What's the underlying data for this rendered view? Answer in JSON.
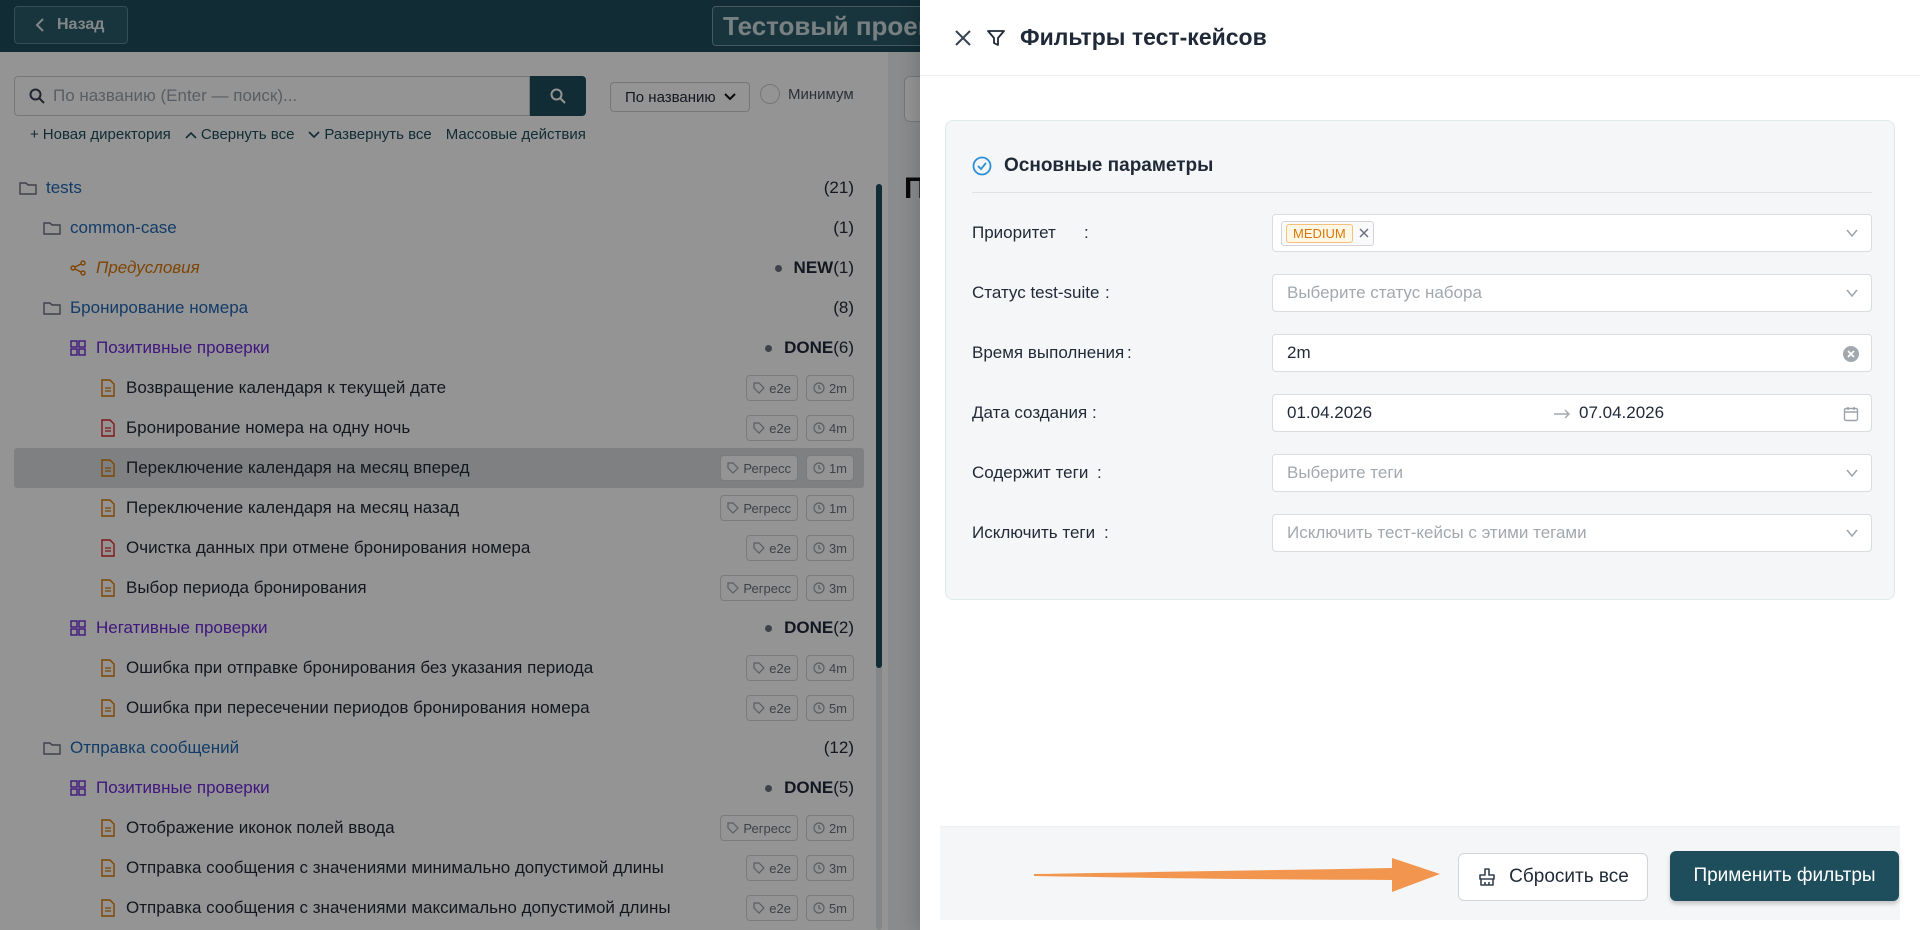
{
  "topbar": {
    "back_label": "Назад",
    "project_title": "Тестовый проект"
  },
  "toolbar": {
    "search_placeholder": "По названию (Enter — поиск)...",
    "sort_value": "По названию",
    "minimum_label": "Минимум"
  },
  "actions": {
    "new_dir": "Новая директория",
    "collapse_all": "Свернуть все",
    "expand_all": "Развернуть все",
    "bulk": "Массовые действия"
  },
  "tree": [
    {
      "kind": "dir",
      "level": 0,
      "label": "tests",
      "count": "(21)"
    },
    {
      "kind": "dir",
      "level": 1,
      "label": "common-case",
      "count": "(1)"
    },
    {
      "kind": "pre",
      "level": 2,
      "label": "Предусловия",
      "status": "NEW",
      "count": "(1)"
    },
    {
      "kind": "dir",
      "level": 1,
      "label": "Бронирование номера",
      "count": "(8)"
    },
    {
      "kind": "suite",
      "level": 2,
      "label": "Позитивные проверки",
      "status": "DONE",
      "count": "(6)"
    },
    {
      "kind": "case",
      "level": 3,
      "label": "Возвращение календаря к текущей дате",
      "tag": "e2e",
      "time": "2m",
      "icon_color": "#d97706"
    },
    {
      "kind": "case",
      "level": 3,
      "label": "Бронирование номера на одну ночь",
      "tag": "e2e",
      "time": "4m",
      "icon_color": "#dc2626"
    },
    {
      "kind": "case",
      "level": 3,
      "label": "Переключение календаря на месяц вперед",
      "tag": "Регресс",
      "time": "1m",
      "icon_color": "#d97706",
      "selected": true
    },
    {
      "kind": "case",
      "level": 3,
      "label": "Переключение календаря на месяц назад",
      "tag": "Регресс",
      "time": "1m",
      "icon_color": "#d97706"
    },
    {
      "kind": "case",
      "level": 3,
      "label": "Очистка данных при отмене бронирования номера",
      "tag": "e2e",
      "time": "3m",
      "icon_color": "#dc2626"
    },
    {
      "kind": "case",
      "level": 3,
      "label": "Выбор периода бронирования",
      "tag": "Регресс",
      "time": "3m",
      "icon_color": "#d97706"
    },
    {
      "kind": "suite",
      "level": 2,
      "label": "Негативные проверки",
      "status": "DONE",
      "count": "(2)"
    },
    {
      "kind": "case",
      "level": 3,
      "label": "Ошибка при отправке бронирования без указания периода",
      "tag": "e2e",
      "time": "4m",
      "icon_color": "#d97706"
    },
    {
      "kind": "case",
      "level": 3,
      "label": "Ошибка при пересечении периодов бронирования номера",
      "tag": "e2e",
      "time": "5m",
      "icon_color": "#d97706"
    },
    {
      "kind": "dir",
      "level": 1,
      "label": "Отправка сообщений",
      "count": "(12)"
    },
    {
      "kind": "suite",
      "level": 2,
      "label": "Позитивные проверки",
      "status": "DONE",
      "count": "(5)"
    },
    {
      "kind": "case",
      "level": 3,
      "label": "Отображение иконок полей ввода",
      "tag": "Регресс",
      "time": "2m",
      "icon_color": "#d97706"
    },
    {
      "kind": "case",
      "level": 3,
      "label": "Отправка сообщения с значениями минимально допустимой длины",
      "tag": "e2e",
      "time": "3m",
      "icon_color": "#d97706"
    },
    {
      "kind": "case",
      "level": 3,
      "label": "Отправка сообщения с значениями максимально допустимой длины",
      "tag": "e2e",
      "time": "5m",
      "icon_color": "#d97706"
    }
  ],
  "right_panel": {
    "heading_letter": "П"
  },
  "drawer": {
    "title": "Фильтры тест-кейсов",
    "section_title": "Основные параметры",
    "fields": {
      "priority": {
        "label": "Приоритет",
        "tag": "MEDIUM"
      },
      "suite_status": {
        "label": "Статус test-suite",
        "placeholder": "Выберите статус набора"
      },
      "exec_time": {
        "label": "Время выполнения",
        "value": "2m"
      },
      "created": {
        "label": "Дата создания",
        "from": "01.04.2026",
        "to": "07.04.2026"
      },
      "has_tags": {
        "label": "Содержит теги",
        "placeholder": "Выберите теги"
      },
      "exclude_tags": {
        "label": "Исключить теги",
        "placeholder": "Исключить тест-кейсы с этими тегами"
      }
    },
    "reset_label": "Сбросить все",
    "apply_label": "Применить фильтры"
  },
  "colors": {
    "primary": "#1e4d5c",
    "dir_link": "#2268b4",
    "suite": "#6d28d9",
    "precondition": "#d97706",
    "annotation_arrow": "#f28c3c"
  },
  "icons": [
    "chevron-left-icon",
    "search-icon",
    "plus-icon",
    "chevron-up-icon",
    "chevron-down-icon",
    "folder-icon",
    "share-icon",
    "grid-icon",
    "file-icon",
    "tag-icon",
    "clock-icon",
    "close-icon",
    "filter-icon",
    "check-circle-icon",
    "calendar-icon",
    "clear-icon",
    "broom-icon"
  ]
}
